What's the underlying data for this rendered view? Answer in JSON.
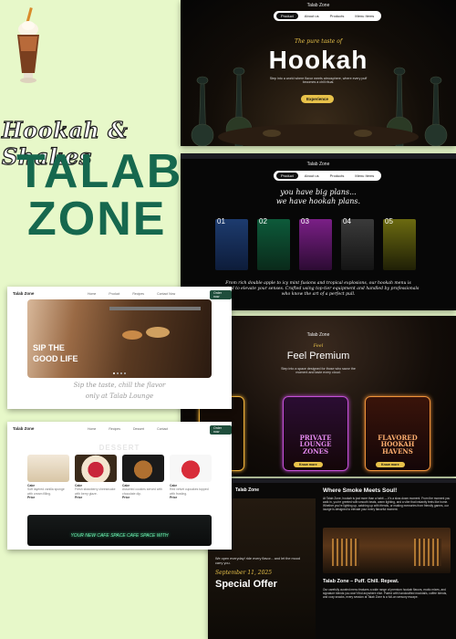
{
  "brand": {
    "tagline": "Hookah & Shakes",
    "title_line1": "TALAB",
    "title_line2": "ZONE",
    "colors": {
      "background": "#e7f8c9",
      "title": "#16684e",
      "gold": "#e8c24a"
    }
  },
  "hero_shot": {
    "site_name": "Talab Zone",
    "nav": [
      "Product",
      "About us",
      "Products",
      "Menu Items"
    ],
    "script_heading": "The pure taste of",
    "heading": "Hookah",
    "description": "Step into a world where flavor meets atmosphere, where every puff becomes a chill ritual.",
    "cta": "Experience"
  },
  "flavors_shot": {
    "site_name": "Talab Zone",
    "nav": [
      "Product",
      "About us",
      "Products",
      "Menu Items"
    ],
    "heading_line1": "you have big plans...",
    "heading_line2": "we have hookah plans.",
    "numbers": [
      "01",
      "02",
      "03",
      "04",
      "05"
    ],
    "paragraph": "From rich double apple to icy mint fusions and tropical explosions, our hookah menu is curated to elevate your senses. Crafted using top-tier equipment and handled by professionals who know the art of a perfect pull."
  },
  "premium_shot": {
    "site_name": "Talab Zone",
    "script": "Feel",
    "heading": "Feel Premium",
    "subheading": "Step into a space designed for those who savor the moment and taste every cloud.",
    "cards": [
      {
        "title": "PRIVATE LOUNGE ZONES",
        "color": "#c54fd8",
        "button": "Know more"
      },
      {
        "title": "FLAVORED HOOKAH HAVENS",
        "color": "#f0923a",
        "button": "Know more"
      }
    ],
    "partial_card_button": "Know more"
  },
  "about_shot": {
    "site_name": "Talab Zone",
    "heading": "Where Smoke Meets Soul!",
    "body": "At Talab Zone, hookah is just more than a habit — it's a slow-down moment. From the moment you walk in, you're greeted with smooth beats, warm lighting, and a vibe that instantly feels like home. Whether you're lighting up, catching up with friends, or making memories from friendly games, our lounge is designed to elevate your every flavorful moment.",
    "tag_heading": "Talab Zone – Puff. Chill. Repeat.",
    "tag_body": "Our carefully curated menu features a wide range of premium hookah flavors, exotic mixes, and signature blends you won't find anywhere else. Paired with handcrafted mocktails, coffee blends, and cozy snacks, every session at Talab Zone is a full-on sensory escape.",
    "offer_caption": "We open everyday! ride every flavor... and let the mood carry you.",
    "offer_date": "September 11, 2025",
    "offer_heading": "Special Offer"
  },
  "cafe_shot": {
    "site_name": "Talab Zone",
    "nav": [
      "Home",
      "Product",
      "Recipes",
      "Contact Now"
    ],
    "nav_button": "Order now",
    "hero_text_line1": "SIP THE",
    "hero_text_line2": "GOOD LIFE",
    "script_line1": "Sip the taste, chill the flavor",
    "script_line2": "only at Talab Lounge"
  },
  "dessert_shot": {
    "site_name": "Talab Zone",
    "nav": [
      "Home",
      "Recipes",
      "Dessert",
      "Contact"
    ],
    "nav_button": "Order now",
    "section_title": "DESSERT",
    "items": [
      {
        "name": "Cake",
        "desc": "Soft layered vanilla sponge with cream filling.",
        "price": "Price"
      },
      {
        "name": "Cake",
        "desc": "Fresh strawberry cheesecake with berry glaze.",
        "price": "Price"
      },
      {
        "name": "Cake",
        "desc": "Assorted cookies served with chocolate dip.",
        "price": "Price"
      },
      {
        "name": "Cake",
        "desc": "Red velvet cupcakes topped with frosting.",
        "price": "Price"
      }
    ],
    "neon_text": "YOUR NEW CAFE SPACE CAFE SPACE WITH"
  }
}
